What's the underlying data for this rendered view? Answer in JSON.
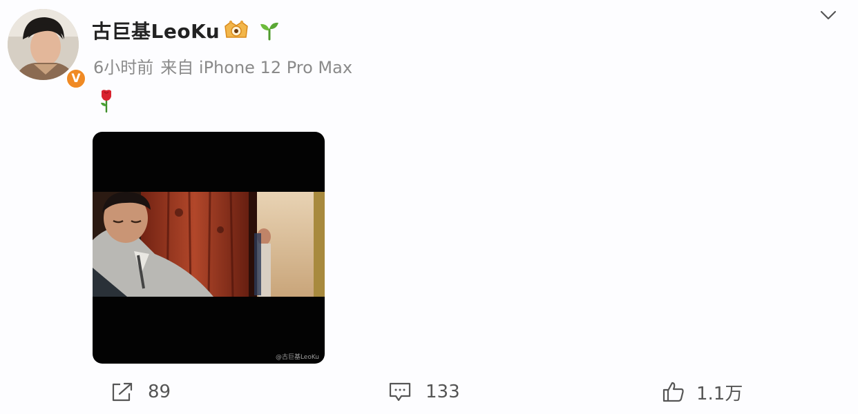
{
  "post": {
    "author": {
      "name": "古巨基LeoKu",
      "verified_badge": "V",
      "badges": [
        "vip-crown-icon",
        "sprout-icon"
      ]
    },
    "meta": {
      "time": "6小时前",
      "source": "来自 iPhone 12 Pro Max"
    },
    "content": {
      "emoji": "rose-icon"
    },
    "video": {
      "watermark": "@古巨基LeoKu"
    },
    "actions": {
      "repost_count": "89",
      "comment_count": "133",
      "like_count": "1.1万"
    }
  },
  "colors": {
    "background": "#fdfdff",
    "username": "#222222",
    "meta": "#8a8a8a",
    "verified": "#f08a24",
    "count": "#555555"
  }
}
